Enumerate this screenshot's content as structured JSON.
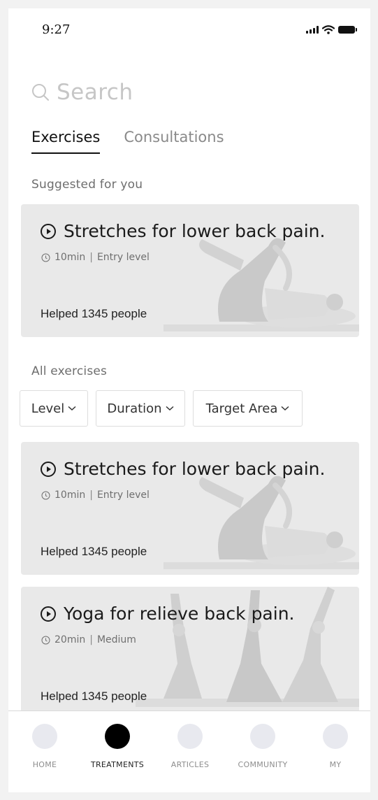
{
  "status_bar": {
    "time": "9:27"
  },
  "search": {
    "placeholder": "Search"
  },
  "tabs": [
    {
      "label": "Exercises",
      "active": true
    },
    {
      "label": "Consultations",
      "active": false
    }
  ],
  "suggested": {
    "heading": "Suggested for you",
    "card": {
      "title": "Stretches for lower back pain.",
      "duration": "10min",
      "level": "Entry level",
      "helped": "Helped 1345 people"
    }
  },
  "all_exercises": {
    "heading": "All exercises",
    "filters": [
      "Level",
      "Duration",
      "Target Area"
    ],
    "cards": [
      {
        "title": "Stretches for lower back pain.",
        "duration": "10min",
        "level": "Entry level",
        "helped": "Helped 1345 people"
      },
      {
        "title": "Yoga for relieve back pain.",
        "duration": "20min",
        "level": "Medium",
        "helped": "Helped 1345 people"
      }
    ],
    "separator": "|"
  },
  "bottom_nav": [
    {
      "label": "HOME",
      "active": false
    },
    {
      "label": "TREATMENTS",
      "active": true
    },
    {
      "label": "ARTICLES",
      "active": false
    },
    {
      "label": "COMMUNITY",
      "active": false
    },
    {
      "label": "MY",
      "active": false
    }
  ],
  "colors": {
    "card_bg": "#e9e9e9",
    "active": "#000000",
    "inactive_dot": "#e8e9ef"
  }
}
